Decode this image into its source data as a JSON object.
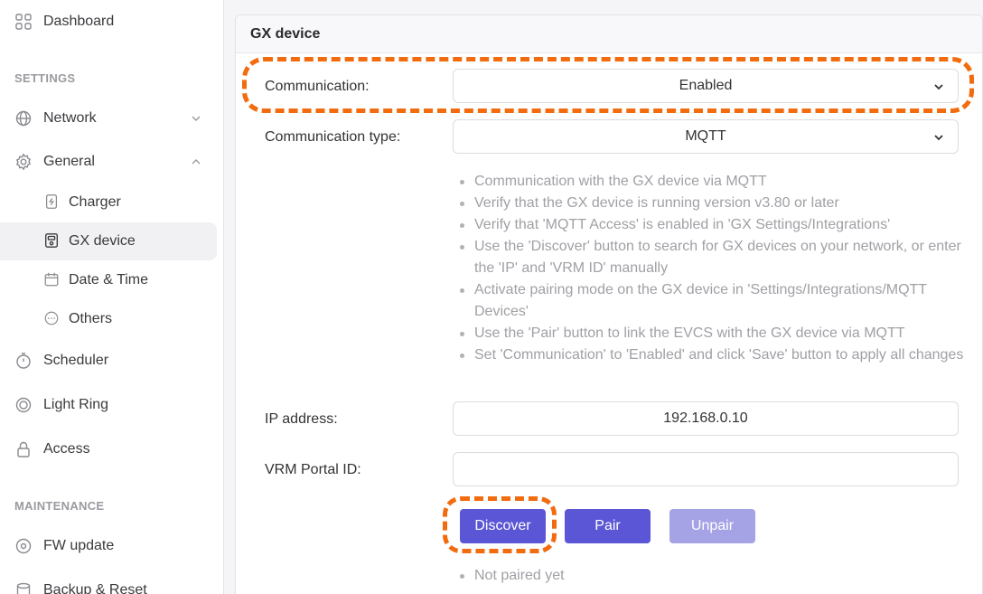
{
  "sidebar": {
    "dashboard": "Dashboard",
    "settings_section": "SETTINGS",
    "network": "Network",
    "general": "General",
    "charger": "Charger",
    "gx_device": "GX device",
    "date_time": "Date & Time",
    "others": "Others",
    "scheduler": "Scheduler",
    "light_ring": "Light Ring",
    "access": "Access",
    "maintenance_section": "MAINTENANCE",
    "fw_update": "FW update",
    "backup_reset": "Backup & Reset"
  },
  "card": {
    "title": "GX device",
    "communication_label": "Communication:",
    "communication_value": "Enabled",
    "communication_type_label": "Communication type:",
    "communication_type_value": "MQTT",
    "help": [
      "Communication with the GX device via MQTT",
      "Verify that the GX device is running version v3.80 or later",
      "Verify that 'MQTT Access' is enabled in 'GX Settings/Integrations'",
      "Use the 'Discover' button to search for GX devices on your network, or enter the 'IP' and 'VRM ID' manually",
      "Activate pairing mode on the GX device in 'Settings/Integrations/MQTT Devices'",
      "Use the 'Pair' button to link the EVCS with the GX device via MQTT",
      "Set 'Communication' to 'Enabled' and click 'Save' button to apply all changes"
    ],
    "ip_label": "IP address:",
    "ip_value": "192.168.0.10",
    "vrm_label": "VRM Portal ID:",
    "vrm_value": "",
    "discover_label": "Discover",
    "pair_label": "Pair",
    "unpair_label": "Unpair",
    "status": "Not paired yet"
  },
  "colors": {
    "accent": "#5b56d6",
    "accent_disabled": "#a5a2e6",
    "highlight": "#f26b0f"
  }
}
